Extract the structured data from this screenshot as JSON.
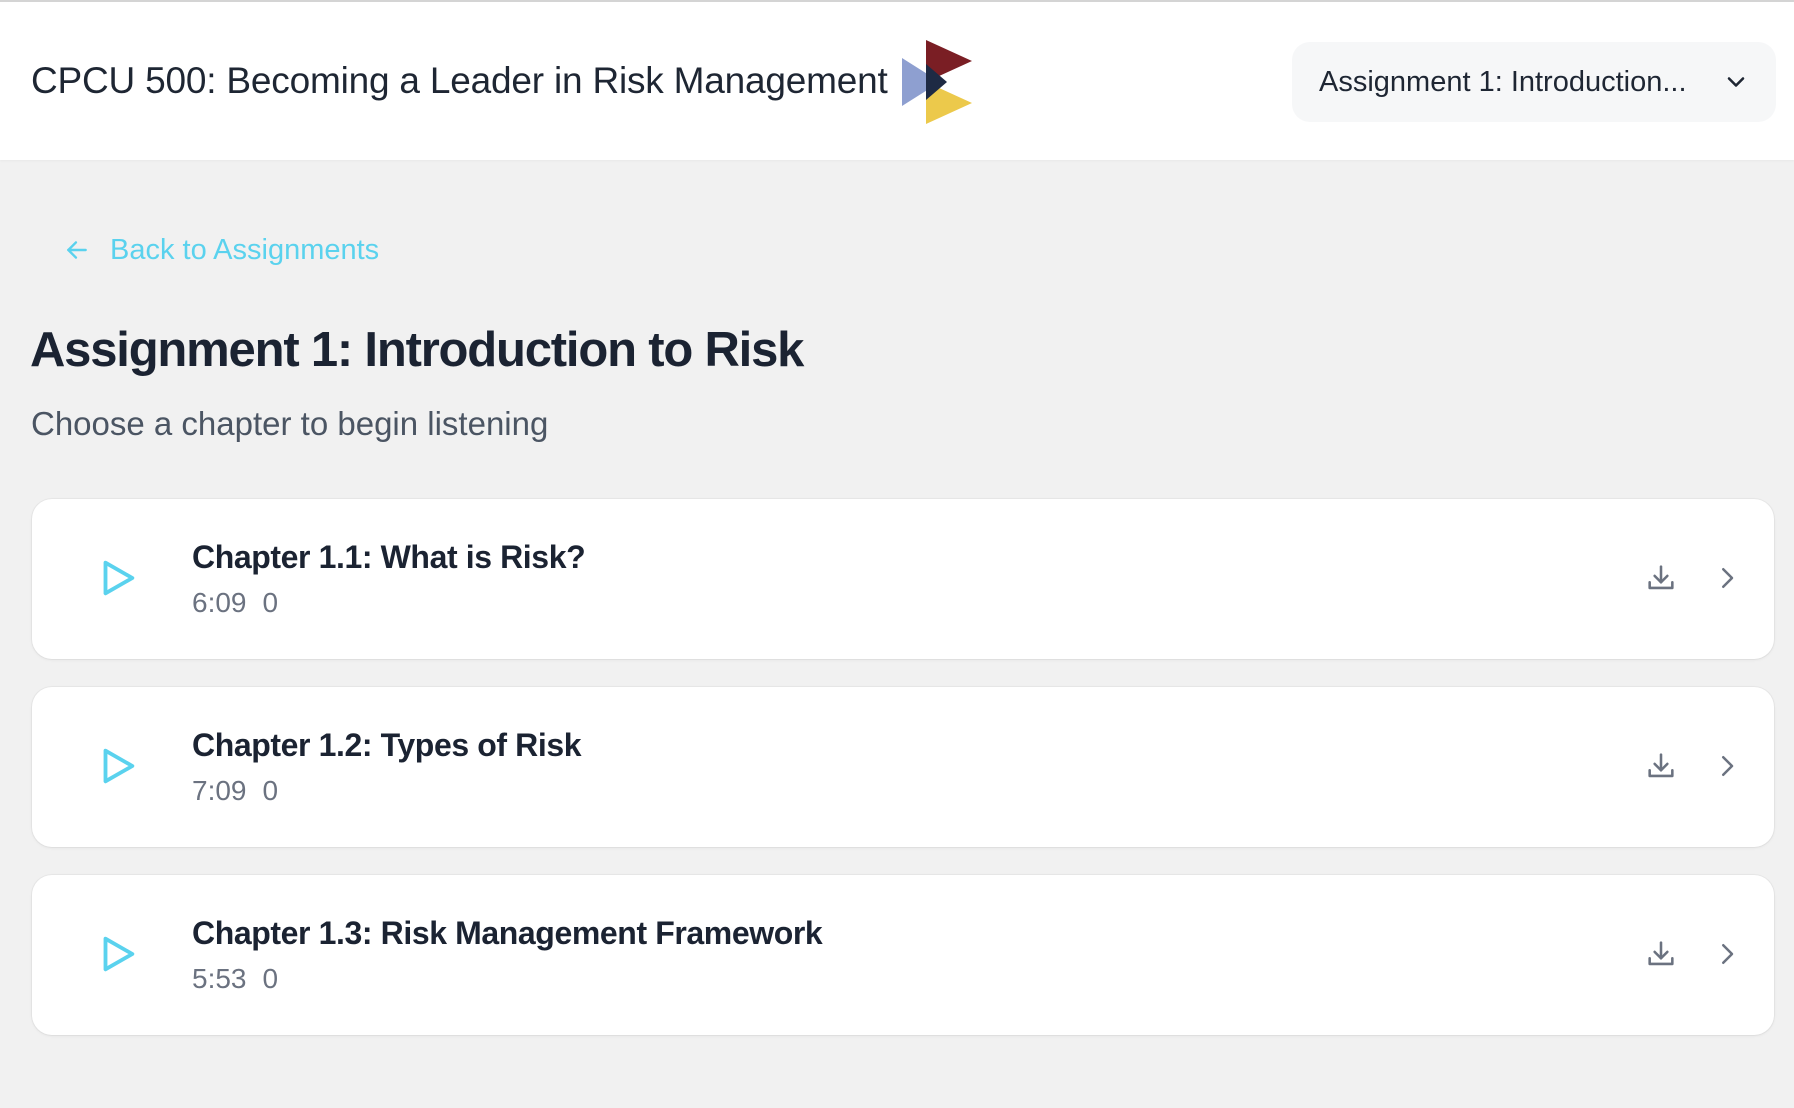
{
  "header": {
    "course_title": "CPCU 500: Becoming a Leader in Risk Management",
    "assignment_selector": {
      "selected": "Assignment 1: Introduction...",
      "icon": "chevron-down-icon"
    },
    "logo": {
      "colors": [
        "#7a1e24",
        "#1e2a44",
        "#8e9fd0",
        "#ecc94b"
      ]
    }
  },
  "nav": {
    "back_label": "Back to Assignments",
    "back_icon": "arrow-left-icon"
  },
  "main": {
    "title": "Assignment 1: Introduction to Risk",
    "subtitle": "Choose a chapter to begin listening",
    "chapters": [
      {
        "title": "Chapter 1.1: What is Risk?",
        "duration": "6:09",
        "count": "0"
      },
      {
        "title": "Chapter 1.2: Types of Risk",
        "duration": "7:09",
        "count": "0"
      },
      {
        "title": "Chapter 1.3: Risk Management Framework",
        "duration": "5:53",
        "count": "0"
      }
    ]
  },
  "colors": {
    "accent": "#5ad2ee",
    "background": "#f1f1f1",
    "card": "#ffffff",
    "text_primary": "#1b2332",
    "text_secondary": "#6b7280"
  }
}
